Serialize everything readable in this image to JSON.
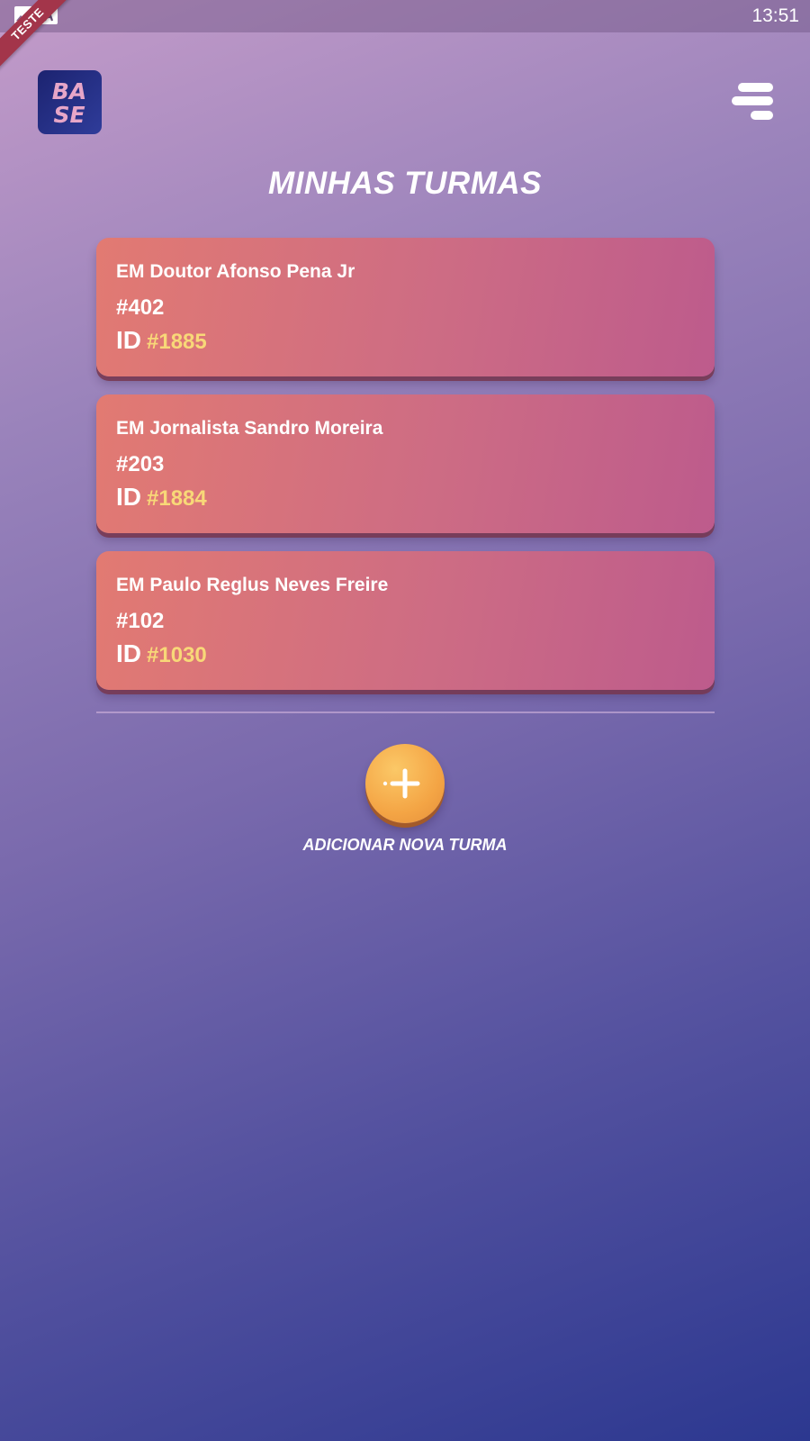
{
  "status_bar": {
    "time": "13:51",
    "icons": [
      "image-icon",
      "text-a-icon"
    ]
  },
  "debug_banner": "TESTE",
  "header": {
    "logo": {
      "text_line1": "BA",
      "text_line2": "SE"
    },
    "menu_icon": "hamburger-menu-icon"
  },
  "page_title": "MINHAS TURMAS",
  "classes": [
    {
      "school": "EM Doutor Afonso Pena Jr",
      "code": "#402",
      "id_label": "ID",
      "id_value": "#1885"
    },
    {
      "school": "EM Jornalista Sandro Moreira",
      "code": "#203",
      "id_label": "ID",
      "id_value": "#1884"
    },
    {
      "school": "EM Paulo Reglus Neves Freire",
      "code": "#102",
      "id_label": "ID",
      "id_value": "#1030"
    }
  ],
  "add_class": {
    "icon": "plus-icon",
    "label": "ADICIONAR NOVA TURMA"
  },
  "colors": {
    "card_gradient_start": "#e27a72",
    "card_gradient_end": "#bd5b8c",
    "id_accent": "#f8d878",
    "add_button": "#f4a545",
    "background_top": "#c39bc9",
    "background_bottom": "#2c3890"
  }
}
